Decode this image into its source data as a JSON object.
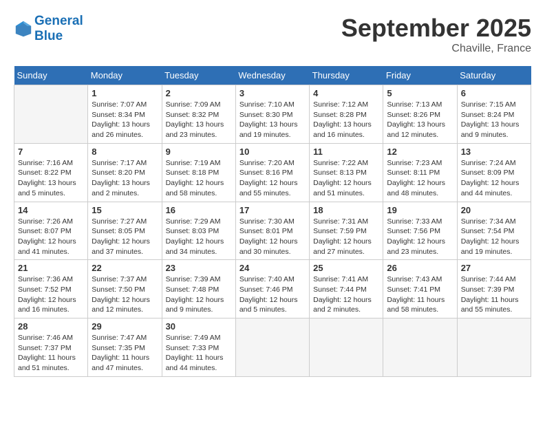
{
  "header": {
    "logo_line1": "General",
    "logo_line2": "Blue",
    "month": "September 2025",
    "location": "Chaville, France"
  },
  "days_of_week": [
    "Sunday",
    "Monday",
    "Tuesday",
    "Wednesday",
    "Thursday",
    "Friday",
    "Saturday"
  ],
  "weeks": [
    [
      {
        "day": "",
        "sunrise": "",
        "sunset": "",
        "daylight": ""
      },
      {
        "day": "1",
        "sunrise": "Sunrise: 7:07 AM",
        "sunset": "Sunset: 8:34 PM",
        "daylight": "Daylight: 13 hours and 26 minutes."
      },
      {
        "day": "2",
        "sunrise": "Sunrise: 7:09 AM",
        "sunset": "Sunset: 8:32 PM",
        "daylight": "Daylight: 13 hours and 23 minutes."
      },
      {
        "day": "3",
        "sunrise": "Sunrise: 7:10 AM",
        "sunset": "Sunset: 8:30 PM",
        "daylight": "Daylight: 13 hours and 19 minutes."
      },
      {
        "day": "4",
        "sunrise": "Sunrise: 7:12 AM",
        "sunset": "Sunset: 8:28 PM",
        "daylight": "Daylight: 13 hours and 16 minutes."
      },
      {
        "day": "5",
        "sunrise": "Sunrise: 7:13 AM",
        "sunset": "Sunset: 8:26 PM",
        "daylight": "Daylight: 13 hours and 12 minutes."
      },
      {
        "day": "6",
        "sunrise": "Sunrise: 7:15 AM",
        "sunset": "Sunset: 8:24 PM",
        "daylight": "Daylight: 13 hours and 9 minutes."
      }
    ],
    [
      {
        "day": "7",
        "sunrise": "Sunrise: 7:16 AM",
        "sunset": "Sunset: 8:22 PM",
        "daylight": "Daylight: 13 hours and 5 minutes."
      },
      {
        "day": "8",
        "sunrise": "Sunrise: 7:17 AM",
        "sunset": "Sunset: 8:20 PM",
        "daylight": "Daylight: 13 hours and 2 minutes."
      },
      {
        "day": "9",
        "sunrise": "Sunrise: 7:19 AM",
        "sunset": "Sunset: 8:18 PM",
        "daylight": "Daylight: 12 hours and 58 minutes."
      },
      {
        "day": "10",
        "sunrise": "Sunrise: 7:20 AM",
        "sunset": "Sunset: 8:16 PM",
        "daylight": "Daylight: 12 hours and 55 minutes."
      },
      {
        "day": "11",
        "sunrise": "Sunrise: 7:22 AM",
        "sunset": "Sunset: 8:13 PM",
        "daylight": "Daylight: 12 hours and 51 minutes."
      },
      {
        "day": "12",
        "sunrise": "Sunrise: 7:23 AM",
        "sunset": "Sunset: 8:11 PM",
        "daylight": "Daylight: 12 hours and 48 minutes."
      },
      {
        "day": "13",
        "sunrise": "Sunrise: 7:24 AM",
        "sunset": "Sunset: 8:09 PM",
        "daylight": "Daylight: 12 hours and 44 minutes."
      }
    ],
    [
      {
        "day": "14",
        "sunrise": "Sunrise: 7:26 AM",
        "sunset": "Sunset: 8:07 PM",
        "daylight": "Daylight: 12 hours and 41 minutes."
      },
      {
        "day": "15",
        "sunrise": "Sunrise: 7:27 AM",
        "sunset": "Sunset: 8:05 PM",
        "daylight": "Daylight: 12 hours and 37 minutes."
      },
      {
        "day": "16",
        "sunrise": "Sunrise: 7:29 AM",
        "sunset": "Sunset: 8:03 PM",
        "daylight": "Daylight: 12 hours and 34 minutes."
      },
      {
        "day": "17",
        "sunrise": "Sunrise: 7:30 AM",
        "sunset": "Sunset: 8:01 PM",
        "daylight": "Daylight: 12 hours and 30 minutes."
      },
      {
        "day": "18",
        "sunrise": "Sunrise: 7:31 AM",
        "sunset": "Sunset: 7:59 PM",
        "daylight": "Daylight: 12 hours and 27 minutes."
      },
      {
        "day": "19",
        "sunrise": "Sunrise: 7:33 AM",
        "sunset": "Sunset: 7:56 PM",
        "daylight": "Daylight: 12 hours and 23 minutes."
      },
      {
        "day": "20",
        "sunrise": "Sunrise: 7:34 AM",
        "sunset": "Sunset: 7:54 PM",
        "daylight": "Daylight: 12 hours and 19 minutes."
      }
    ],
    [
      {
        "day": "21",
        "sunrise": "Sunrise: 7:36 AM",
        "sunset": "Sunset: 7:52 PM",
        "daylight": "Daylight: 12 hours and 16 minutes."
      },
      {
        "day": "22",
        "sunrise": "Sunrise: 7:37 AM",
        "sunset": "Sunset: 7:50 PM",
        "daylight": "Daylight: 12 hours and 12 minutes."
      },
      {
        "day": "23",
        "sunrise": "Sunrise: 7:39 AM",
        "sunset": "Sunset: 7:48 PM",
        "daylight": "Daylight: 12 hours and 9 minutes."
      },
      {
        "day": "24",
        "sunrise": "Sunrise: 7:40 AM",
        "sunset": "Sunset: 7:46 PM",
        "daylight": "Daylight: 12 hours and 5 minutes."
      },
      {
        "day": "25",
        "sunrise": "Sunrise: 7:41 AM",
        "sunset": "Sunset: 7:44 PM",
        "daylight": "Daylight: 12 hours and 2 minutes."
      },
      {
        "day": "26",
        "sunrise": "Sunrise: 7:43 AM",
        "sunset": "Sunset: 7:41 PM",
        "daylight": "Daylight: 11 hours and 58 minutes."
      },
      {
        "day": "27",
        "sunrise": "Sunrise: 7:44 AM",
        "sunset": "Sunset: 7:39 PM",
        "daylight": "Daylight: 11 hours and 55 minutes."
      }
    ],
    [
      {
        "day": "28",
        "sunrise": "Sunrise: 7:46 AM",
        "sunset": "Sunset: 7:37 PM",
        "daylight": "Daylight: 11 hours and 51 minutes."
      },
      {
        "day": "29",
        "sunrise": "Sunrise: 7:47 AM",
        "sunset": "Sunset: 7:35 PM",
        "daylight": "Daylight: 11 hours and 47 minutes."
      },
      {
        "day": "30",
        "sunrise": "Sunrise: 7:49 AM",
        "sunset": "Sunset: 7:33 PM",
        "daylight": "Daylight: 11 hours and 44 minutes."
      },
      {
        "day": "",
        "sunrise": "",
        "sunset": "",
        "daylight": ""
      },
      {
        "day": "",
        "sunrise": "",
        "sunset": "",
        "daylight": ""
      },
      {
        "day": "",
        "sunrise": "",
        "sunset": "",
        "daylight": ""
      },
      {
        "day": "",
        "sunrise": "",
        "sunset": "",
        "daylight": ""
      }
    ]
  ]
}
